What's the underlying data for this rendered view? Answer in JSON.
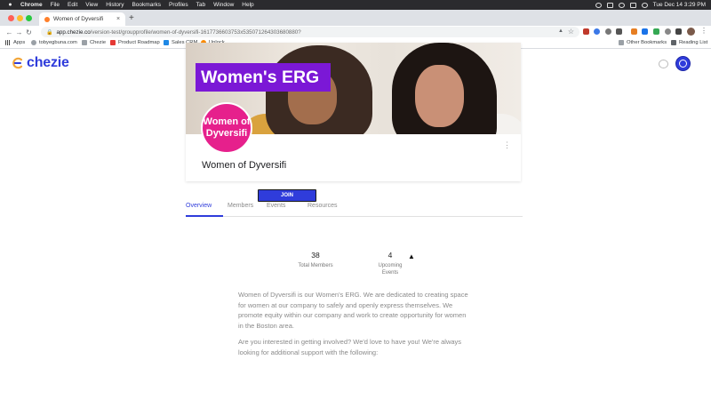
{
  "menubar": {
    "app": "Chrome",
    "items": [
      "File",
      "Edit",
      "View",
      "History",
      "Bookmarks",
      "Profiles",
      "Tab",
      "Window",
      "Help"
    ],
    "clock": "Tue Dec 14  3:29 PM"
  },
  "browser": {
    "tab_title": "Women of Dyversifi",
    "url_host": "app.chezie.co",
    "url_path": "/version-test/groupprofile/women-of-dyversifi-1617736603753x535071264303680880?"
  },
  "bookmarks": {
    "apps": "Apps",
    "items": [
      "tobyegbuna.com",
      "Chezie",
      "Product Roadmap",
      "Sales CRM",
      "Unlock"
    ],
    "other": "Other Bookmarks",
    "reading_list": "Reading List"
  },
  "site": {
    "brand": "chezie",
    "colors": {
      "primary": "#2f3cdb",
      "banner_label": "#7b18d6",
      "group_logo": "#e6208c"
    }
  },
  "group": {
    "banner_title": "Women's ERG",
    "logo_text": "Women of Dyversifi",
    "name": "Women of Dyversifi",
    "join_label": "JOIN"
  },
  "tabs": [
    {
      "label": "Overview",
      "active": true
    },
    {
      "label": "Members",
      "active": false
    },
    {
      "label": "Events",
      "active": false
    },
    {
      "label": "Resources",
      "active": false
    }
  ],
  "stats": [
    {
      "value": "38",
      "label": "Total Members"
    },
    {
      "value": "4",
      "label": "Upcoming Events"
    }
  ],
  "description": {
    "p1": "Women of Dyversifi is our Women's ERG. We are dedicated to creating space for women at our company to safely and openly express themselves. We promote equity within our company and work to create opportunity for women in the Boston area.",
    "p2": "Are you interested in getting involved? We'd love to have you! We're always looking for additional support with the following:"
  }
}
